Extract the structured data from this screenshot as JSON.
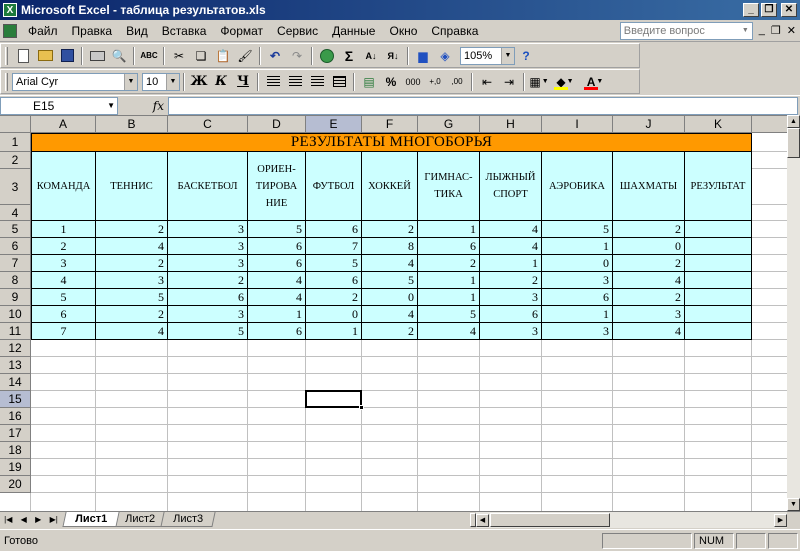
{
  "window": {
    "title": "Microsoft Excel - таблица результатов.xls"
  },
  "menu": {
    "items": [
      "Файл",
      "Правка",
      "Вид",
      "Вставка",
      "Формат",
      "Сервис",
      "Данные",
      "Окно",
      "Справка"
    ],
    "help_placeholder": "Введите вопрос"
  },
  "toolbar": {
    "zoom": "105%",
    "font_name": "Arial Cyr",
    "font_size": "10",
    "bold": "Ж",
    "italic": "К",
    "underline": "Ч",
    "percent": "%",
    "thousands": "000",
    "sigma": "Σ"
  },
  "formula_bar": {
    "name_box": "E15",
    "fx": "fx",
    "value": ""
  },
  "sheet": {
    "columns": [
      "A",
      "B",
      "C",
      "D",
      "E",
      "F",
      "G",
      "H",
      "I",
      "J",
      "K"
    ],
    "active_column": "E",
    "rows": [
      "1",
      "2",
      "3",
      "4",
      "5",
      "6",
      "7",
      "8",
      "9",
      "10",
      "11",
      "12",
      "13",
      "14",
      "15",
      "16",
      "17",
      "18",
      "19",
      "20"
    ],
    "active_row": "15",
    "title": "РЕЗУЛЬТАТЫ МНОГОБОРЬЯ",
    "headers": [
      "КОМАНДА",
      "ТЕННИС",
      "БАСКЕТБОЛ",
      "ОРИЕН-ТИРОВА НИЕ",
      "ФУТБОЛ",
      "ХОККЕЙ",
      "ГИМНАС-ТИКА",
      "ЛЫЖНЫЙ СПОРТ",
      "АЭРОБИКА",
      "ШАХМАТЫ",
      "РЕЗУЛЬТАТ"
    ],
    "header_lines": [
      [
        "КОМАНДА"
      ],
      [
        "ТЕННИС"
      ],
      [
        "БАСКЕТБОЛ"
      ],
      [
        "ОРИЕН-",
        "ТИРОВА",
        "НИЕ"
      ],
      [
        "ФУТБОЛ"
      ],
      [
        "ХОККЕЙ"
      ],
      [
        "ГИМНАС-",
        "ТИКА"
      ],
      [
        "ЛЫЖНЫЙ",
        "СПОРТ"
      ],
      [
        "АЭРОБИКА"
      ],
      [
        "ШАХМАТЫ"
      ],
      [
        "РЕЗУЛЬТАТ"
      ]
    ],
    "data": [
      [
        "1",
        "2",
        "3",
        "5",
        "6",
        "2",
        "1",
        "4",
        "5",
        "2",
        ""
      ],
      [
        "2",
        "4",
        "3",
        "6",
        "7",
        "8",
        "6",
        "4",
        "1",
        "0",
        ""
      ],
      [
        "3",
        "2",
        "3",
        "6",
        "5",
        "4",
        "2",
        "1",
        "0",
        "2",
        ""
      ],
      [
        "4",
        "3",
        "2",
        "4",
        "6",
        "5",
        "1",
        "2",
        "3",
        "4",
        ""
      ],
      [
        "5",
        "5",
        "6",
        "4",
        "2",
        "0",
        "1",
        "3",
        "6",
        "2",
        ""
      ],
      [
        "6",
        "2",
        "3",
        "1",
        "0",
        "4",
        "5",
        "6",
        "1",
        "3",
        ""
      ],
      [
        "7",
        "4",
        "5",
        "6",
        "1",
        "2",
        "4",
        "3",
        "3",
        "4",
        ""
      ]
    ]
  },
  "tabs": {
    "sheets": [
      "Лист1",
      "Лист2",
      "Лист3"
    ],
    "active": "Лист1"
  },
  "status": {
    "ready": "Готово",
    "num": "NUM"
  },
  "colors": {
    "title_fill": "#ff9900",
    "table_fill": "#ccffff"
  }
}
